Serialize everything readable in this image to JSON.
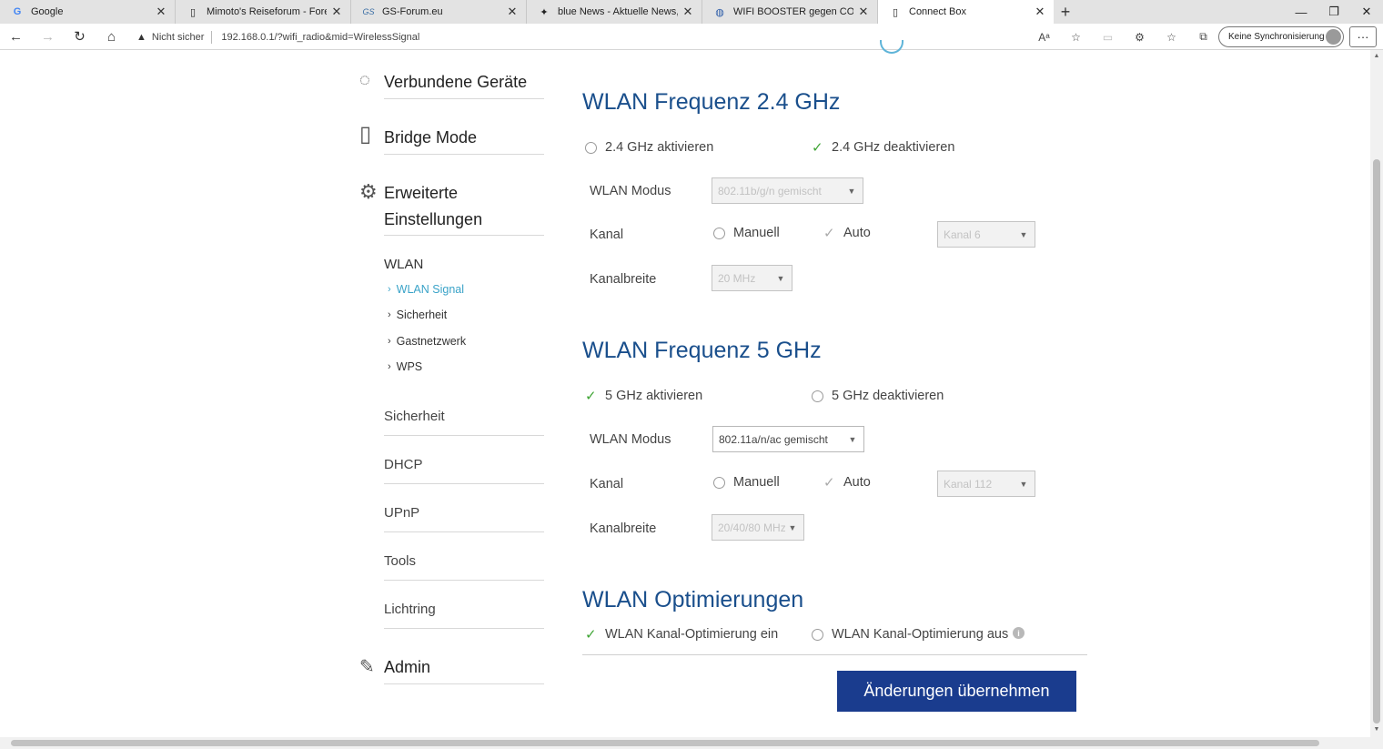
{
  "browser": {
    "tabs": [
      {
        "title": "Google",
        "icon": "G"
      },
      {
        "title": "Mimoto's Reiseforum - Foren-Üb",
        "icon": "page"
      },
      {
        "title": "GS-Forum.eu",
        "icon": "GS"
      },
      {
        "title": "blue News - Aktuelle News, best",
        "icon": "bird"
      },
      {
        "title": "WIFI BOOSTER gegen CONNECT",
        "icon": "globe"
      },
      {
        "title": "Connect Box",
        "icon": "page"
      }
    ],
    "security_label": "Nicht sicher",
    "url": "192.168.0.1/?wifi_radio&mid=WirelessSignal",
    "sync_label": "Keine Synchronisierung"
  },
  "sidebar": {
    "connected_devices": "Verbundene Geräte",
    "bridge_mode": "Bridge Mode",
    "advanced_line1": "Erweiterte",
    "advanced_line2": "Einstellungen",
    "wlan": "WLAN",
    "wlan_items": [
      "WLAN Signal",
      "Sicherheit",
      "Gastnetzwerk",
      "WPS"
    ],
    "sections": [
      "Sicherheit",
      "DHCP",
      "UPnP",
      "Tools",
      "Lichtring"
    ],
    "admin": "Admin"
  },
  "band24": {
    "heading": "WLAN Frequenz 2.4 GHz",
    "enable_label": "2.4 GHz aktivieren",
    "disable_label": "2.4 GHz deaktivieren",
    "mode_label": "WLAN Modus",
    "mode_value": "802.11b/g/n gemischt",
    "channel_label": "Kanal",
    "manual_label": "Manuell",
    "auto_label": "Auto",
    "channel_value": "Kanal 6",
    "width_label": "Kanalbreite",
    "width_value": "20 MHz"
  },
  "band5": {
    "heading": "WLAN Frequenz 5 GHz",
    "enable_label": "5 GHz aktivieren",
    "disable_label": "5 GHz deaktivieren",
    "mode_label": "WLAN Modus",
    "mode_value": "802.11a/n/ac gemischt",
    "channel_label": "Kanal",
    "manual_label": "Manuell",
    "auto_label": "Auto",
    "channel_value": "Kanal 112",
    "width_label": "Kanalbreite",
    "width_value": "20/40/80 MHz"
  },
  "optimization": {
    "heading": "WLAN Optimierungen",
    "on_label": "WLAN Kanal-Optimierung ein",
    "off_label": "WLAN Kanal-Optimierung aus"
  },
  "apply_label": "Änderungen übernehmen",
  "colors": {
    "heading": "#1a4f8c",
    "button": "#1a3c8e",
    "check": "#3fa535",
    "active_link": "#3aa3c8"
  }
}
